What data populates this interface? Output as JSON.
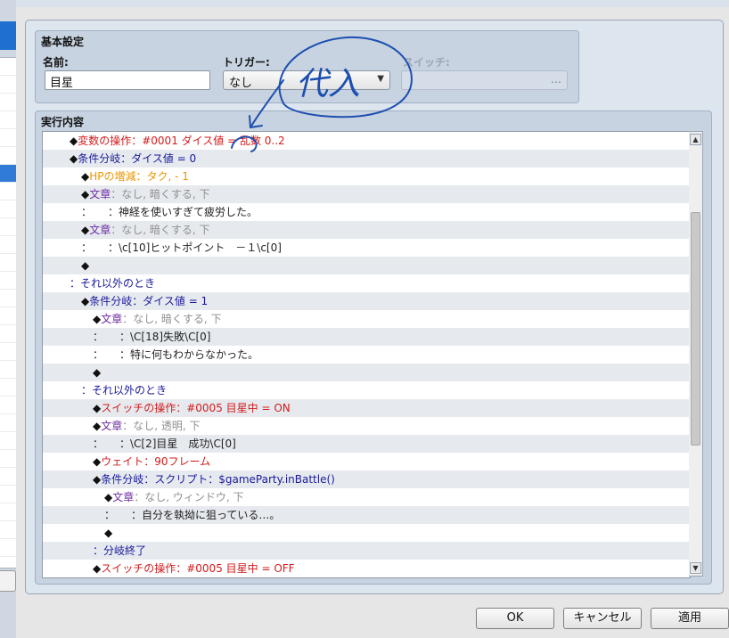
{
  "basic": {
    "title": "基本設定",
    "name_label": "名前:",
    "name_value": "目星",
    "trigger_label": "トリガー:",
    "trigger_value": "なし",
    "switch_label": "スイッチ:",
    "switch_button": "…"
  },
  "execution": {
    "title": "実行内容",
    "rows": [
      {
        "indent": 30,
        "parts": [
          {
            "t": "◆",
            "c": "dia"
          },
          {
            "t": "変数の操作：#0001 ダイス値 = 乱数 0..2",
            "c": "red"
          }
        ]
      },
      {
        "indent": 30,
        "parts": [
          {
            "t": "◆",
            "c": "dia"
          },
          {
            "t": "条件分岐：ダイス値 = 0",
            "c": "k"
          }
        ]
      },
      {
        "indent": 43,
        "parts": [
          {
            "t": "◆",
            "c": "dia"
          },
          {
            "t": "HPの増減：タク, - 1",
            "c": "orange"
          }
        ]
      },
      {
        "indent": 43,
        "parts": [
          {
            "t": "◆",
            "c": "dia"
          },
          {
            "t": "文章",
            "c": "purple"
          },
          {
            "t": "：なし, 暗くする, 下",
            "c": "gray"
          }
        ]
      },
      {
        "indent": 43,
        "parts": [
          {
            "t": "：　　：神経を使いすぎて疲労した。",
            "c": "text"
          }
        ]
      },
      {
        "indent": 43,
        "parts": [
          {
            "t": "◆",
            "c": "dia"
          },
          {
            "t": "文章",
            "c": "purple"
          },
          {
            "t": "：なし, 暗くする, 下",
            "c": "gray"
          }
        ]
      },
      {
        "indent": 43,
        "parts": [
          {
            "t": "：　　：\\c[10]ヒットポイント　－１\\c[0]",
            "c": "text"
          }
        ]
      },
      {
        "indent": 43,
        "parts": [
          {
            "t": "◆",
            "c": "dia"
          }
        ]
      },
      {
        "indent": 30,
        "parts": [
          {
            "t": "：それ以外のとき",
            "c": "k"
          }
        ]
      },
      {
        "indent": 43,
        "parts": [
          {
            "t": "◆",
            "c": "dia"
          },
          {
            "t": "条件分岐：ダイス値 = 1",
            "c": "k"
          }
        ]
      },
      {
        "indent": 56,
        "parts": [
          {
            "t": "◆",
            "c": "dia"
          },
          {
            "t": "文章",
            "c": "purple"
          },
          {
            "t": "：なし, 暗くする, 下",
            "c": "gray"
          }
        ]
      },
      {
        "indent": 56,
        "parts": [
          {
            "t": "：　　：\\C[18]失敗\\C[0]",
            "c": "text"
          }
        ]
      },
      {
        "indent": 56,
        "parts": [
          {
            "t": "：　　：特に何もわからなかった。",
            "c": "text"
          }
        ]
      },
      {
        "indent": 56,
        "parts": [
          {
            "t": "◆",
            "c": "dia"
          }
        ]
      },
      {
        "indent": 43,
        "parts": [
          {
            "t": "：それ以外のとき",
            "c": "k"
          }
        ]
      },
      {
        "indent": 56,
        "parts": [
          {
            "t": "◆",
            "c": "dia"
          },
          {
            "t": "スイッチの操作：#0005 目星中 = ON",
            "c": "red"
          }
        ]
      },
      {
        "indent": 56,
        "parts": [
          {
            "t": "◆",
            "c": "dia"
          },
          {
            "t": "文章",
            "c": "purple"
          },
          {
            "t": "：なし, 透明, 下",
            "c": "gray"
          }
        ]
      },
      {
        "indent": 56,
        "parts": [
          {
            "t": "：　　：\\C[2]目星　成功\\C[0]",
            "c": "text"
          }
        ]
      },
      {
        "indent": 56,
        "parts": [
          {
            "t": "◆",
            "c": "dia"
          },
          {
            "t": "ウェイト：90フレーム",
            "c": "red"
          }
        ]
      },
      {
        "indent": 56,
        "parts": [
          {
            "t": "◆",
            "c": "dia"
          },
          {
            "t": "条件分岐：スクリプト：",
            "c": "k"
          },
          {
            "t": "$gameParty.inBattle()",
            "c": "k"
          }
        ]
      },
      {
        "indent": 69,
        "parts": [
          {
            "t": "◆",
            "c": "dia"
          },
          {
            "t": "文章",
            "c": "purple"
          },
          {
            "t": "：なし, ウィンドウ, 下",
            "c": "gray"
          }
        ]
      },
      {
        "indent": 69,
        "parts": [
          {
            "t": "：　　：自分を執拗に狙っている…。",
            "c": "text"
          }
        ]
      },
      {
        "indent": 69,
        "parts": [
          {
            "t": "◆",
            "c": "dia"
          }
        ]
      },
      {
        "indent": 56,
        "parts": [
          {
            "t": "：分岐終了",
            "c": "k"
          }
        ]
      },
      {
        "indent": 56,
        "parts": [
          {
            "t": "◆",
            "c": "dia"
          },
          {
            "t": "スイッチの操作：#0005 目星中 = OFF",
            "c": "red"
          }
        ]
      }
    ]
  },
  "scrollbar": {
    "up": "▲",
    "down": "▼"
  },
  "annotation": {
    "text": "代入",
    "color": "#1d4fb0"
  },
  "buttons": {
    "ok": "OK",
    "cancel": "キャンセル",
    "apply": "適用"
  }
}
